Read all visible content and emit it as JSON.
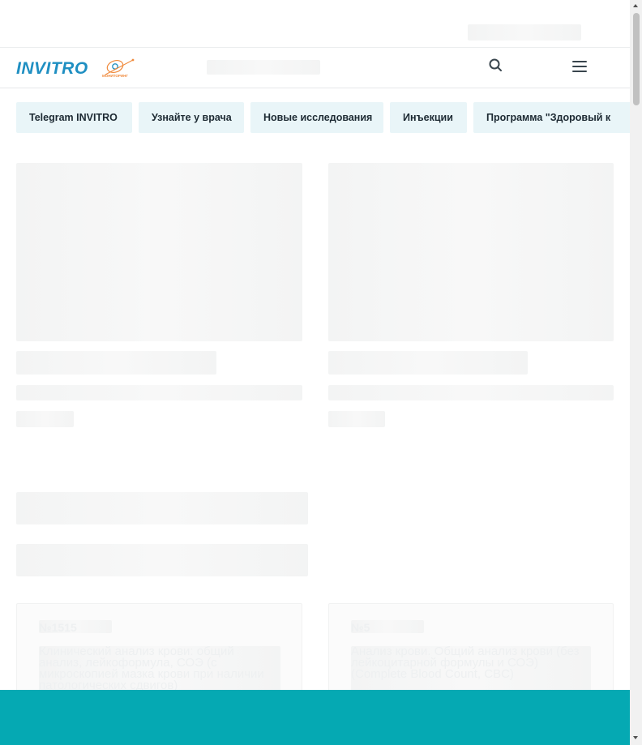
{
  "header": {
    "logo_text": "INVITRO",
    "logo_sub": "МОНИТОРИНГ",
    "colors": {
      "brand": "#1f8fc2",
      "accent": "#f08a3c",
      "chip_bg": "#e9f5f8",
      "bottom_bar": "#05a9b3"
    }
  },
  "icons": {
    "search": "search-icon",
    "menu": "hamburger-menu-icon"
  },
  "chips": [
    {
      "label": "Telegram INVITRO"
    },
    {
      "label": "Узнайте у врача"
    },
    {
      "label": "Новые исследования"
    },
    {
      "label": "Инъекции"
    },
    {
      "label": "Программа \"Здоровый к"
    }
  ],
  "analyses": [
    {
      "number": "№1515",
      "title": "Клинический анализ крови: общий анализ, лейкоформула, СОЭ (с микроскопией мазка крови при наличии патологических сдвигов)"
    },
    {
      "number": "№5",
      "title": "Анализ крови. Общий анализ крови (без лейкоцитарной формулы и СОЭ) (Complete Blood Count, CBC)"
    }
  ]
}
